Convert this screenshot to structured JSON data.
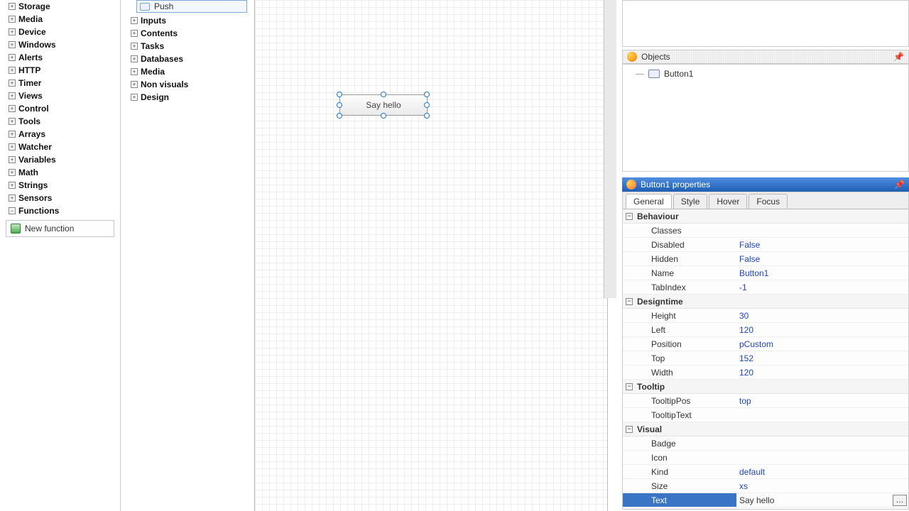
{
  "leftTree": {
    "items": [
      "Storage",
      "Media",
      "Device",
      "Windows",
      "Alerts",
      "HTTP",
      "Timer",
      "Views",
      "Control",
      "Tools",
      "Arrays",
      "Watcher",
      "Variables",
      "Math",
      "Strings",
      "Sensors",
      "Functions"
    ],
    "expanded": 16,
    "newFunction": "New function"
  },
  "midTree": {
    "pushLabel": "Push",
    "items": [
      "Inputs",
      "Contents",
      "Tasks",
      "Databases",
      "Media",
      "Non visuals",
      "Design"
    ]
  },
  "canvasButton": {
    "text": "Say hello"
  },
  "objects": {
    "title": "Objects",
    "items": [
      "Button1"
    ]
  },
  "properties": {
    "title": "Button1 properties",
    "tabs": [
      "General",
      "Style",
      "Hover",
      "Focus"
    ],
    "activeTab": 0,
    "groups": [
      {
        "name": "Behaviour",
        "rows": [
          {
            "k": "Classes",
            "v": ""
          },
          {
            "k": "Disabled",
            "v": "False"
          },
          {
            "k": "Hidden",
            "v": "False"
          },
          {
            "k": "Name",
            "v": "Button1"
          },
          {
            "k": "TabIndex",
            "v": "-1"
          }
        ]
      },
      {
        "name": "Designtime",
        "rows": [
          {
            "k": "Height",
            "v": "30"
          },
          {
            "k": "Left",
            "v": "120"
          },
          {
            "k": "Position",
            "v": "pCustom"
          },
          {
            "k": "Top",
            "v": "152"
          },
          {
            "k": "Width",
            "v": "120"
          }
        ]
      },
      {
        "name": "Tooltip",
        "rows": [
          {
            "k": "TooltipPos",
            "v": "top"
          },
          {
            "k": "TooltipText",
            "v": ""
          }
        ]
      },
      {
        "name": "Visual",
        "rows": [
          {
            "k": "Badge",
            "v": ""
          },
          {
            "k": "Icon",
            "v": ""
          },
          {
            "k": "Kind",
            "v": "default"
          },
          {
            "k": "Size",
            "v": "xs"
          },
          {
            "k": "Text",
            "v": "Say hello",
            "selected": true,
            "ell": true
          }
        ]
      }
    ]
  }
}
